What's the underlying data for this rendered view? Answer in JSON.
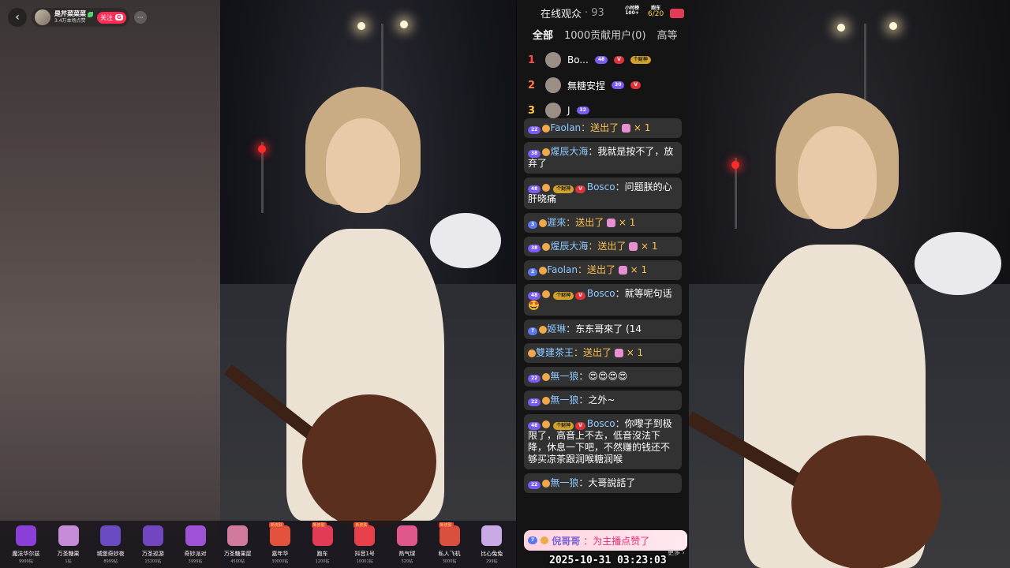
{
  "streamer": {
    "name": "是芹菜菜菜",
    "sub": "3.4万本场点赞",
    "follow_label": "关注",
    "follow_badge": "G",
    "back": "‹",
    "more": "···"
  },
  "panel": {
    "online_label": "在线观众",
    "online_count": "· 93",
    "small_gift_label": "小时榜",
    "small_gift_count": "100+",
    "car_label": "跑车",
    "car_progress": "6/20",
    "tabs": [
      "全部",
      "1000贡献用户(0)",
      "高等"
    ]
  },
  "ranking": [
    {
      "rank": "1",
      "name": "Bo...",
      "badges": [
        "48",
        "V",
        "个财神"
      ]
    },
    {
      "rank": "2",
      "name": "無糖安捏",
      "badges": [
        "30",
        "V"
      ]
    },
    {
      "rank": "3",
      "name": "J",
      "badges": [
        "32"
      ]
    }
  ],
  "chat": [
    {
      "level": "22",
      "user": "Faolan",
      "text": "：送出了",
      "gift": true,
      "count": "× 1",
      "partial": true
    },
    {
      "level": "38",
      "user": "煋辰大海",
      "text": "：我就是按不了，放弃了"
    },
    {
      "level": "48",
      "extra": "个财神",
      "vip": "V",
      "user": "Bosco",
      "text": "：问题朕的心肝晓痛"
    },
    {
      "level": "3",
      "user": "遲來",
      "text": "：送出了",
      "gift": true,
      "count": "× 1"
    },
    {
      "level": "38",
      "user": "煋辰大海",
      "text": "：送出了",
      "gift": true,
      "count": "× 1"
    },
    {
      "level": "2",
      "user": "Faolan",
      "text": "：送出了",
      "gift": true,
      "count": "× 1"
    },
    {
      "level": "48",
      "extra": "个财神",
      "vip": "V",
      "user": "Bosco",
      "text": "：就等呢句话🤩"
    },
    {
      "level": "7",
      "user": "姬琳",
      "text": "：东东哥來了 (14"
    },
    {
      "level": "",
      "user": "雙建茶王",
      "text": "：送出了",
      "gift": true,
      "count": "× 1"
    },
    {
      "level": "22",
      "user": "無一狼",
      "text": "：😍😍😍😍"
    },
    {
      "level": "22",
      "user": "無一狼",
      "text": "：之外~"
    },
    {
      "level": "48",
      "extra": "个财神",
      "vip": "V",
      "user": "Bosco",
      "text": "：你嚟子到极限了，高音上不去，低音沒法下降，休息一下吧，不然赚的钱还不够买凉茶跟润喉糖润喉"
    },
    {
      "level": "22",
      "user": "無一狼",
      "text": "：大哥說話了"
    }
  ],
  "like_toast": {
    "level": "7",
    "name": "倪哥哥",
    "text": "：为主播点赞了"
  },
  "timestamp": "2025-10-31 03:23:03",
  "more_link": "更多 ›",
  "gifts": [
    {
      "name": "魔法华尔兹",
      "price": "9999钻",
      "color": "#8a3fd6",
      "tag": ""
    },
    {
      "name": "万圣糖果",
      "price": "1钻",
      "color": "#c58bd6",
      "tag": ""
    },
    {
      "name": "城堡奇妙夜",
      "price": "8999钻",
      "color": "#6a4bc2",
      "tag": ""
    },
    {
      "name": "万圣巡游",
      "price": "15200钻",
      "color": "#7246c0",
      "tag": ""
    },
    {
      "name": "奇妙派对",
      "price": "3999钻",
      "color": "#9e52d6",
      "tag": ""
    },
    {
      "name": "万圣糖果屋",
      "price": "4500钻",
      "color": "#d07a9e",
      "tag": ""
    },
    {
      "name": "嘉年华",
      "price": "30000钻",
      "color": "#e3523d",
      "tag": "新皮肤"
    },
    {
      "name": "跑车",
      "price": "1200钻",
      "color": "#e23b56",
      "tag": "新皮肤"
    },
    {
      "name": "抖音1号",
      "price": "10001钻",
      "color": "#e8404b",
      "tag": "新皮肤"
    },
    {
      "name": "热气球",
      "price": "520钻",
      "color": "#e0578b",
      "tag": ""
    },
    {
      "name": "私人飞机",
      "price": "3000钻",
      "color": "#d9503e",
      "tag": "新皮肤"
    },
    {
      "name": "比心兔兔",
      "price": "299钻",
      "color": "#c9a9e6",
      "tag": ""
    }
  ]
}
